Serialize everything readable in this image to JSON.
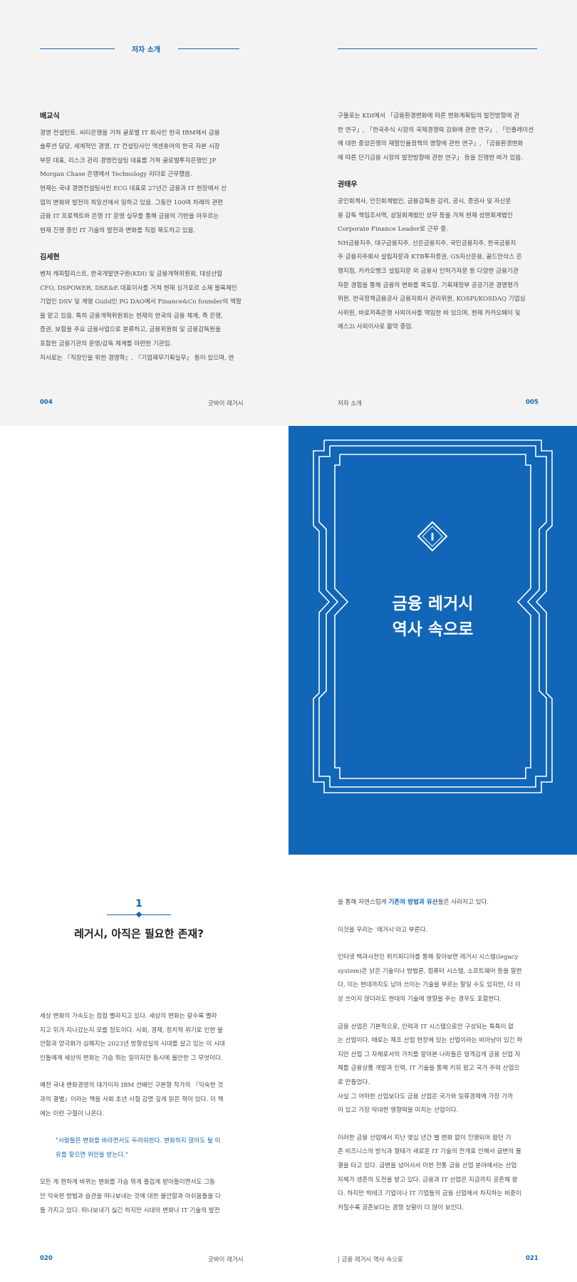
{
  "spread1": {
    "header_title": "저자 소개",
    "left": {
      "authors": [
        {
          "name": "배교식",
          "lines": [
            "경영 컨설턴트. 씨티은행을 거쳐 글로벌 IT 회사인 한국 IBM에서 금융",
            "솔루션 담당, 세계적인 경영, IT 컨설팅사인 액센츄어의 한국 자본 시장",
            "부문 대표, 리스크 관리 경영컨설팅 대표를 거쳐 글로벌투자은행인 JP",
            "Morgan Chase 은행에서 Technology 리더로 근무했음.",
            "현재는 국내 경영컨설팅사인 ECG 대표로 27년간 금융과 IT 현장에서 산",
            "업의 변화와 발전의 최일선에서 일하고 있음. 그동안 100여 차례의 관련",
            "금융 IT 프로젝트와 은행 IT 운영 실무를 통해 금융의 기반을 아우르는",
            "현재 진행 중인 IT 기술의 발전과 변화를 직접 목도하고 있음."
          ]
        },
        {
          "name": "김세현",
          "lines": [
            "벤처 캐피탈리스트, 한국개발연구원(KDI) 및 금융개혁위원회, 대성산업",
            "CFO, DSPOWER, DSE&E 대표이사를 거쳐 현재 싱가포르 소재 블록체인",
            "기업인 DSV 및 계열 Guild인 PG DAO에서 Finance&Co founder의 역할",
            "을 맡고 있음. 특히 금융개혁위원회는 현재의 한국의 금융 체계, 즉 은행,",
            "증권, 보험을 주요 금융사업으로 분류하고, 금융위원회 및 금융감독원을",
            "포함한 금융기관의 운영/감독 체계를 마련한 기관임.",
            "저서로는 『직장인을 위한 경영학』, 『기업재무기획실무』 등이 있으며, 연"
          ]
        }
      ]
    },
    "right": {
      "cont_lines": [
        "구물로는 KDI에서 「금융환경변화에 따른 변화계획팀의 발전방향에 관",
        "한 연구」, 「한국주식 시장의 국제경쟁력 강화에 관한 연구」, 「인플레이션",
        "에 대한 중앙은행의 재할인율정책의 영향에 관한 연구」, 「금융환경변화",
        "에 따른 단기금융 시장의 발전방향에 관한 연구」 등을 진행한 바가 있음."
      ],
      "author": {
        "name": "권태우",
        "lines": [
          "공인회계사, 안진회계법인, 금융감독원 감리, 공시, 증권사 및 자산운",
          "용 감독 책임조사역, 삼일회계법인 상무 등을 거쳐 현재 성현회계법인",
          "Corporate Finance Leader로 근무 중.",
          "NH금융지주, 대구금융지주, 산은금융지주, 국민금융지주, 한국금융지",
          "주 금융지주회사 설립자문과 KTB투자증권, GS자산운용, 골드만삭스 은",
          "행지점, 카카오뱅크 설립자문 외 금융사 인허가자문 등 다양한 금융기관",
          "자문 경험을 통해 금융의 변화를 목도함. 기획재정부 공공기관 경영평가",
          "위원, 한국정책금융공사 금융자회사 관리위원, KOSPI/KOSDAQ 기업심",
          "사위원, 바로저축은행 사외이사를 역임한 바 있으며, 현재 카카오페이 및",
          "에스2i 사외이사로 활약 중임."
        ]
      }
    },
    "folio_left_num": "004",
    "folio_left_text": "굿바이 레거시",
    "folio_right_text": "저자 소개",
    "folio_right_num": "005"
  },
  "chapter": {
    "numeral": "I",
    "title_line1": "금융 레거시",
    "title_line2": "역사 속으로"
  },
  "section": {
    "number": "1",
    "title": "레거시, 아직은 필요한 존재?",
    "left_paragraphs": [
      [
        "세상 변화의 가속도는 점점 빨라지고 있다. 세상의 변화는 갈수록 빨라",
        "지고 뒤가 지나갔는지 모를 정도이다. 사회, 경제, 정치적 위기로 인한 불",
        "안함과 양극화가 심해지는 2023년 방향성실의 시대를 살고 있는 이 시대",
        "인들에게 세상의 변화는 가슴 뛰는 일이지만 동시에 불안한 그 무엇이다."
      ],
      [
        "예전 국내 변화경영의 대가이자 IBM 선배인 구본형 작가의 『익숙한 것",
        "과의 결별』이라는 책을 사회 초년 시절 감명 깊게 읽은 적이 있다. 이 책",
        "에는 이런 구절이 나온다."
      ]
    ],
    "quote_lines": [
      "\"사람들은 변화를 바라면서도 두려워한다. 변화하지 않아도 될 이",
      "유를 찾으면 위안을 받는다.\""
    ],
    "left_after_quote": [
      "모든 게 편하게 바뀌는 변화를 가슴 뛰게 즐겁게 받아들이면서도 그동",
      "안 익숙한 방법과 습관을 떠나보내는 것에 대한 불안함과 아쉬움들을 다",
      "들 가지고 있다. 떠나보내기 싫긴 하지만 시대의 변화나 IT 기술의 발전"
    ],
    "right_first_pre": "을 통해 자연스럽게 ",
    "right_first_highlight": "기존의 방법과 유산",
    "right_first_post": "들은 사라지고 있다.",
    "right_paragraphs": [
      [
        "이것을 우리는 '레거시'라고 부른다."
      ],
      [
        "인터넷 백과사전인 위키피디아를 통해 찾아보면 레거시 시스템(legacy",
        "system)은 낡은 기술이나 방법론, 컴퓨터 시스템, 소프트웨어 등을 말한",
        "다. 이는 현대까지도 남아 쓰이는 기술을 부르는 말일 수도 있지만, 더 이",
        "상 쓰이지 않더라도 현대의 기술에 영향을 주는 경우도 포함한다."
      ],
      [
        "금융 산업은 기본적으로, 인력과 IT 시스템으로만 구성되는 특특이 없",
        "는 산업이다. 때로는 제조 산업 현장에 있는 산업이라는 비아냥이 있긴 하",
        "지만 산업 그 자체로서의 가치를 알아본 나라들은 엄격감게 금융 신업 자",
        "체를 금융상품 개발과 인력, IT 기술을 통해 키워 왔고 국가 주력 산업으",
        "로 만들었다.",
        "사실 그 어떠한 산업보다도 금융 산업은 국가와 일류경제에 가장 가까",
        "이 있고 가장 막대한 영향력을 미치는 산업이다."
      ],
      [
        "이러한 금융 산업에서 지난 몇십 년간 별 변화 없이 진행되어 왔던 기",
        "존 비즈니스의 방식과 형태가 새로운 IT 기술의 전개로 인해서 급변의 물",
        "결을 타고 있다. 급변을 넘어서서 이번 전통 금융 산업 분야에서는 산업",
        "자체가 생존의 도전을 받고 있다. 금융과 IT 산업은 지금까지 공존해 왔",
        "다. 하지만 빅테크 기업이나 IT 기업들의 금융 산업에서 차지하는 비중이",
        "커질수록 공존보다는 경쟁 상황이 더 많이 보인다."
      ]
    ],
    "folio_left_num": "020",
    "folio_left_text": "굿바이 레거시",
    "folio_right_text": "| 금융 레거시 역사 속으로",
    "folio_right_num": "021"
  }
}
